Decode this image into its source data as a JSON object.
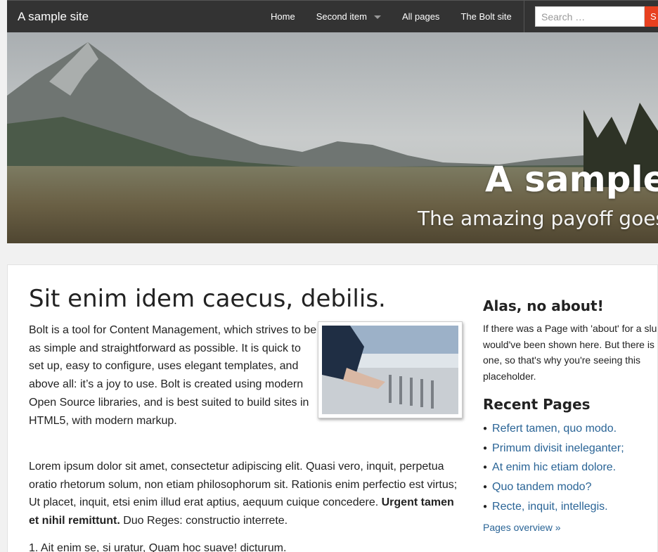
{
  "header": {
    "brand": "A sample site",
    "nav": [
      {
        "label": "Home"
      },
      {
        "label": "Second item"
      },
      {
        "label": "All pages"
      },
      {
        "label": "The Bolt site"
      }
    ],
    "search": {
      "placeholder": "Search …",
      "button_label": "S"
    }
  },
  "hero": {
    "title": "A sample s",
    "subtitle": "The amazing payoff goes h"
  },
  "article": {
    "title": "Sit enim idem caecus, debilis.",
    "intro": "Bolt is a tool for Content Management, which strives to be as simple and straightforward as possible. It is quick to set up, easy to configure, uses elegant templates, and above all: it’s a joy to use. Bolt is created using modern Open Source libraries, and is best suited to build sites in HTML5, with modern markup.",
    "p2_text": "Lorem ipsum dolor sit amet, consectetur adipiscing elit. Quasi vero, inquit, perpetua oratio rhetorum solum, non etiam philosophorum sit. Rationis enim perfectio est virtus; Ut placet, inquit, etsi enim illud erat aptius, aequum cuique concedere. ",
    "p2_bold": "Urgent tamen et nihil remittunt.",
    "p2_tail": " Duo Reges: constructio interrete.",
    "list_first": "1.  Ait enim se, si uratur, Quam hoc suave! dicturum."
  },
  "sidebar": {
    "about_title": "Alas, no about!",
    "about_text": "If there was a Page with 'about' for a slu would've been shown here. But there is one, so that's why you're seeing this placeholder.",
    "recent_title": "Recent Pages",
    "recent": [
      {
        "label": "Refert tamen, quo modo."
      },
      {
        "label": "Primum divisit ineleganter;"
      },
      {
        "label": "At enim hic etiam dolore."
      },
      {
        "label": "Quo tandem modo?"
      },
      {
        "label": "Recte, inquit, intellegis."
      }
    ],
    "overview_link": "Pages overview »"
  },
  "colors": {
    "navbar": "#333333",
    "accent": "#e8401f",
    "link": "#2a6496"
  }
}
